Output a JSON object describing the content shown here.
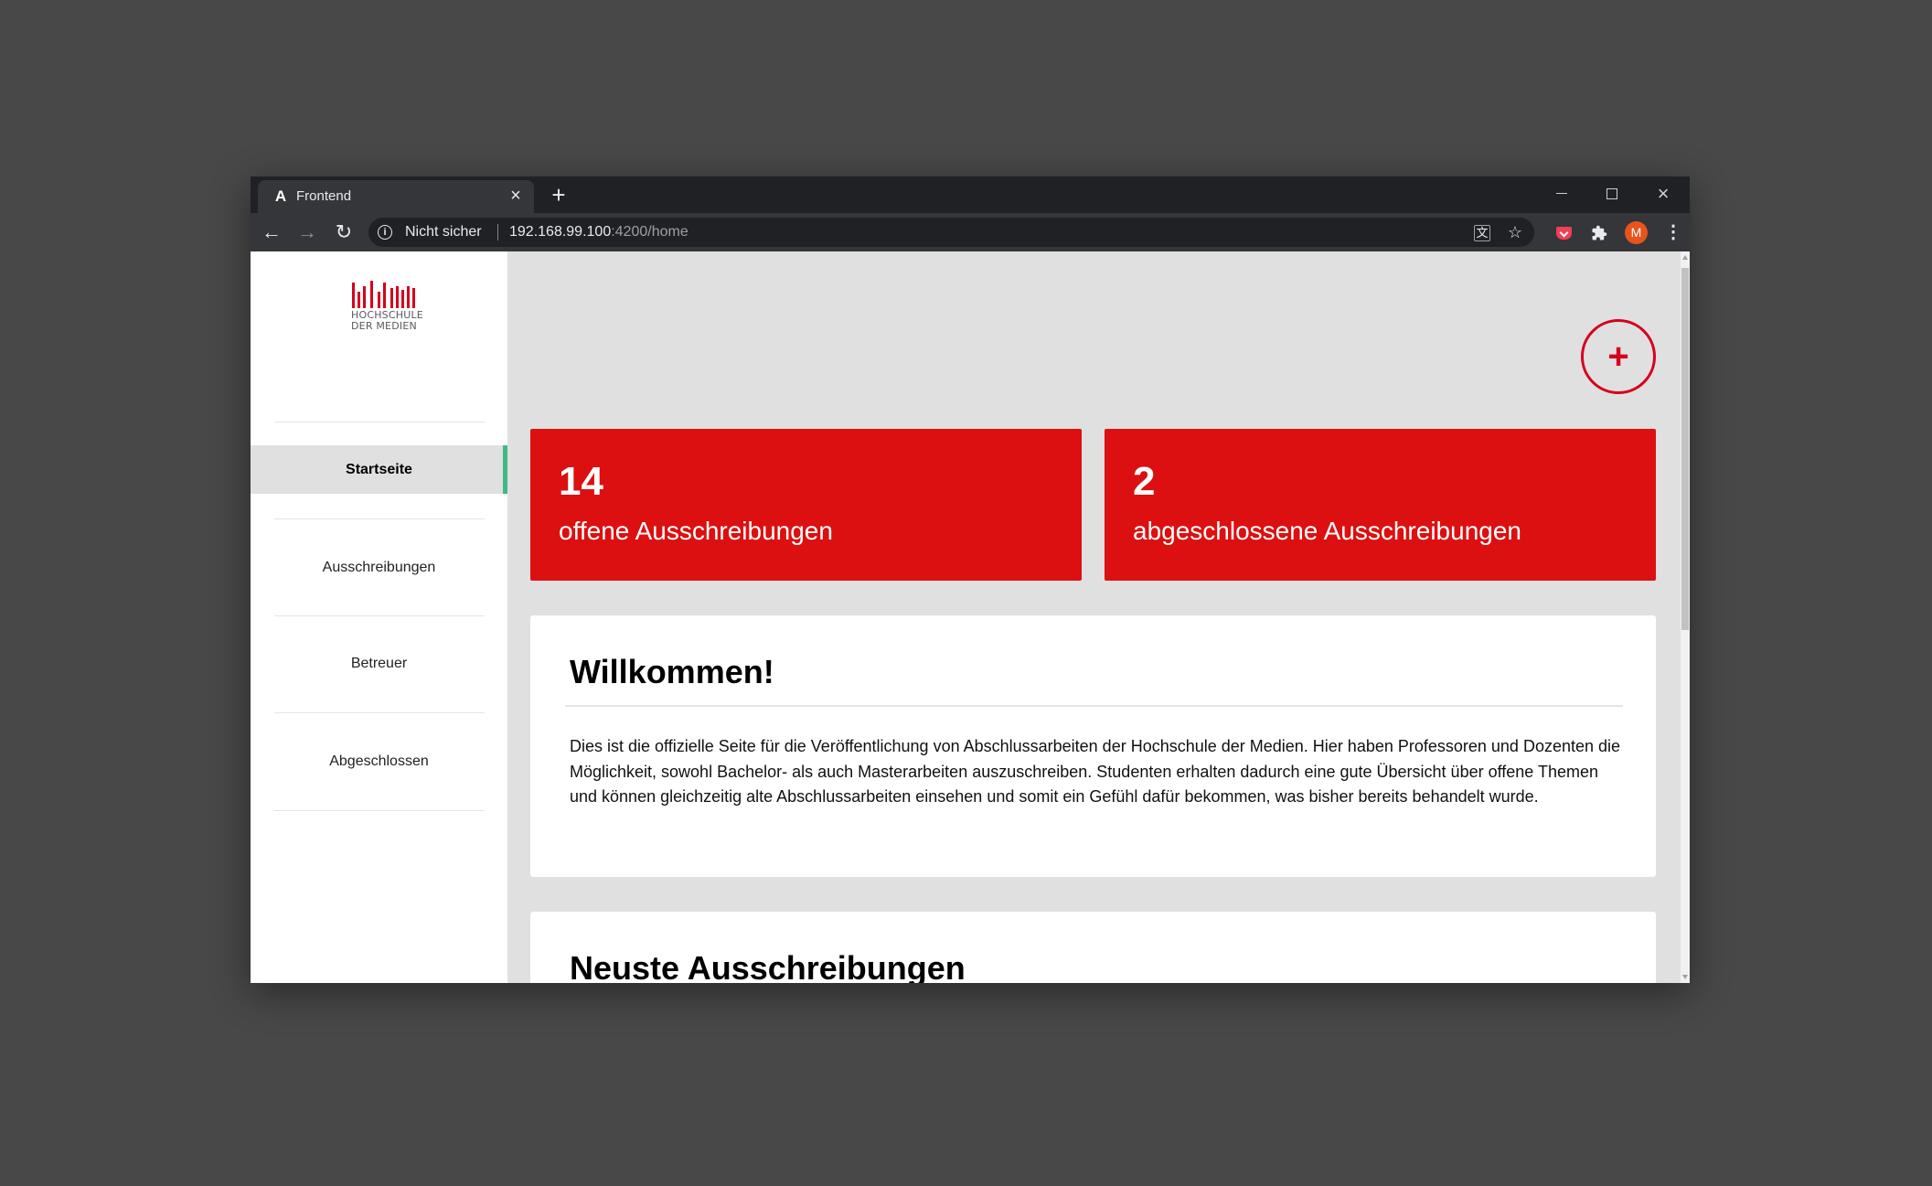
{
  "browser": {
    "tab_title": "Frontend",
    "tab_favicon": "A",
    "new_tab_label": "+",
    "security_label": "Nicht sicher",
    "url_host": "192.168.99.100",
    "url_path": ":4200/home",
    "avatar_letter": "M",
    "icons": [
      "close-icon",
      "plus-icon",
      "minimize-icon",
      "restore-icon",
      "back-arrow-icon",
      "forward-arrow-icon",
      "reload-icon",
      "info-icon",
      "translate-icon",
      "star-icon",
      "pocket-icon",
      "puzzle-icon",
      "more-vert-icon"
    ]
  },
  "sidebar": {
    "logo_lines": [
      "HOCHSCHULE",
      "DER MEDIEN"
    ],
    "logo_color": "#d5001c",
    "items": [
      {
        "label": "Startseite",
        "active": true
      },
      {
        "label": "Ausschreibungen",
        "active": false
      },
      {
        "label": "Betreuer",
        "active": false
      },
      {
        "label": "Abgeschlossen",
        "active": false
      }
    ],
    "active_indicator_color": "#43b883"
  },
  "main": {
    "add_button_label": "+",
    "accent_color": "#dc1010",
    "stats": [
      {
        "value": "14",
        "label": "offene Ausschreibungen"
      },
      {
        "value": "2",
        "label": "abgeschlossene Ausschreibungen"
      }
    ],
    "welcome": {
      "title": "Willkommen!",
      "body": "Dies ist die offizielle Seite für die Veröffentlichung von Abschlussarbeiten der Hochschule der Medien. Hier haben Professoren und Dozenten die Möglichkeit, sowohl Bachelor- als auch Masterarbeiten auszuschreiben. Studenten erhalten dadurch eine gute Übersicht über offene Themen und können gleichzeitig alte Abschlussarbeiten einsehen und somit ein Gefühl dafür bekommen, was bisher bereits behandelt wurde."
    },
    "news": {
      "title": "Neuste Ausschreibungen"
    }
  }
}
